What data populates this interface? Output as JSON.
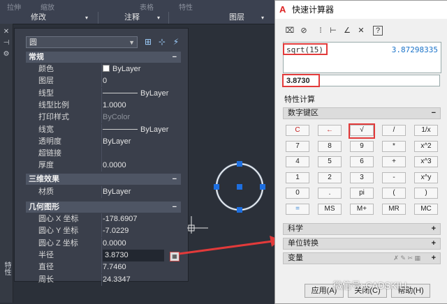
{
  "ribbon": {
    "panels": [
      "修改",
      "注释",
      "图层"
    ],
    "faint_labels": [
      "拉伸",
      "缩放",
      "表格",
      "特性"
    ]
  },
  "left_strip": {
    "icons": [
      "close-icon",
      "pin-icon",
      "settings-icon"
    ],
    "title": "特性"
  },
  "properties": {
    "object_type": "圆",
    "sections": {
      "general": "常规",
      "3d": "三维效果",
      "geometry": "几何图形"
    },
    "general_rows": [
      {
        "label": "颜色",
        "value": "ByLayer"
      },
      {
        "label": "图层",
        "value": "0"
      },
      {
        "label": "线型",
        "value": "ByLayer"
      },
      {
        "label": "线型比例",
        "value": "1.0000"
      },
      {
        "label": "打印样式",
        "value": "ByColor"
      },
      {
        "label": "线宽",
        "value": "ByLayer"
      },
      {
        "label": "透明度",
        "value": "ByLayer"
      },
      {
        "label": "超链接",
        "value": ""
      },
      {
        "label": "厚度",
        "value": "0.0000"
      }
    ],
    "three_d_rows": [
      {
        "label": "材质",
        "value": "ByLayer"
      }
    ],
    "geometry_rows": [
      {
        "label": "圆心 X 坐标",
        "value": "-178.6907"
      },
      {
        "label": "圆心 Y 坐标",
        "value": "-7.0229"
      },
      {
        "label": "圆心 Z 坐标",
        "value": "0.0000"
      },
      {
        "label": "半径",
        "value": "3.8730"
      },
      {
        "label": "直径",
        "value": "7.7460"
      },
      {
        "label": "周长",
        "value": "24.3347"
      }
    ]
  },
  "calculator": {
    "title": "快速计算器",
    "expression": "sqrt(15)",
    "expression_result": "3.87298335",
    "input_value": "3.8730",
    "props_label": "特性计算",
    "sections": {
      "numpad": "数字键区",
      "science": "科学",
      "units": "单位转换",
      "variables": "变量"
    },
    "keys": [
      [
        "C",
        "←",
        "√",
        "/",
        "1/x"
      ],
      [
        "7",
        "8",
        "9",
        "*",
        "x^2"
      ],
      [
        "4",
        "5",
        "6",
        "+",
        "x^3"
      ],
      [
        "1",
        "2",
        "3",
        "-",
        "x^y"
      ],
      [
        "0",
        ".",
        "pi",
        "(",
        ")"
      ],
      [
        "=",
        "MS",
        "M+",
        "MR",
        "MC"
      ]
    ],
    "footer": {
      "apply": "应用(A)",
      "close": "关闭(C)",
      "help": "帮助(H)"
    },
    "accent_color": "#e23a3a"
  },
  "watermark": "微信号: CADSKILL"
}
